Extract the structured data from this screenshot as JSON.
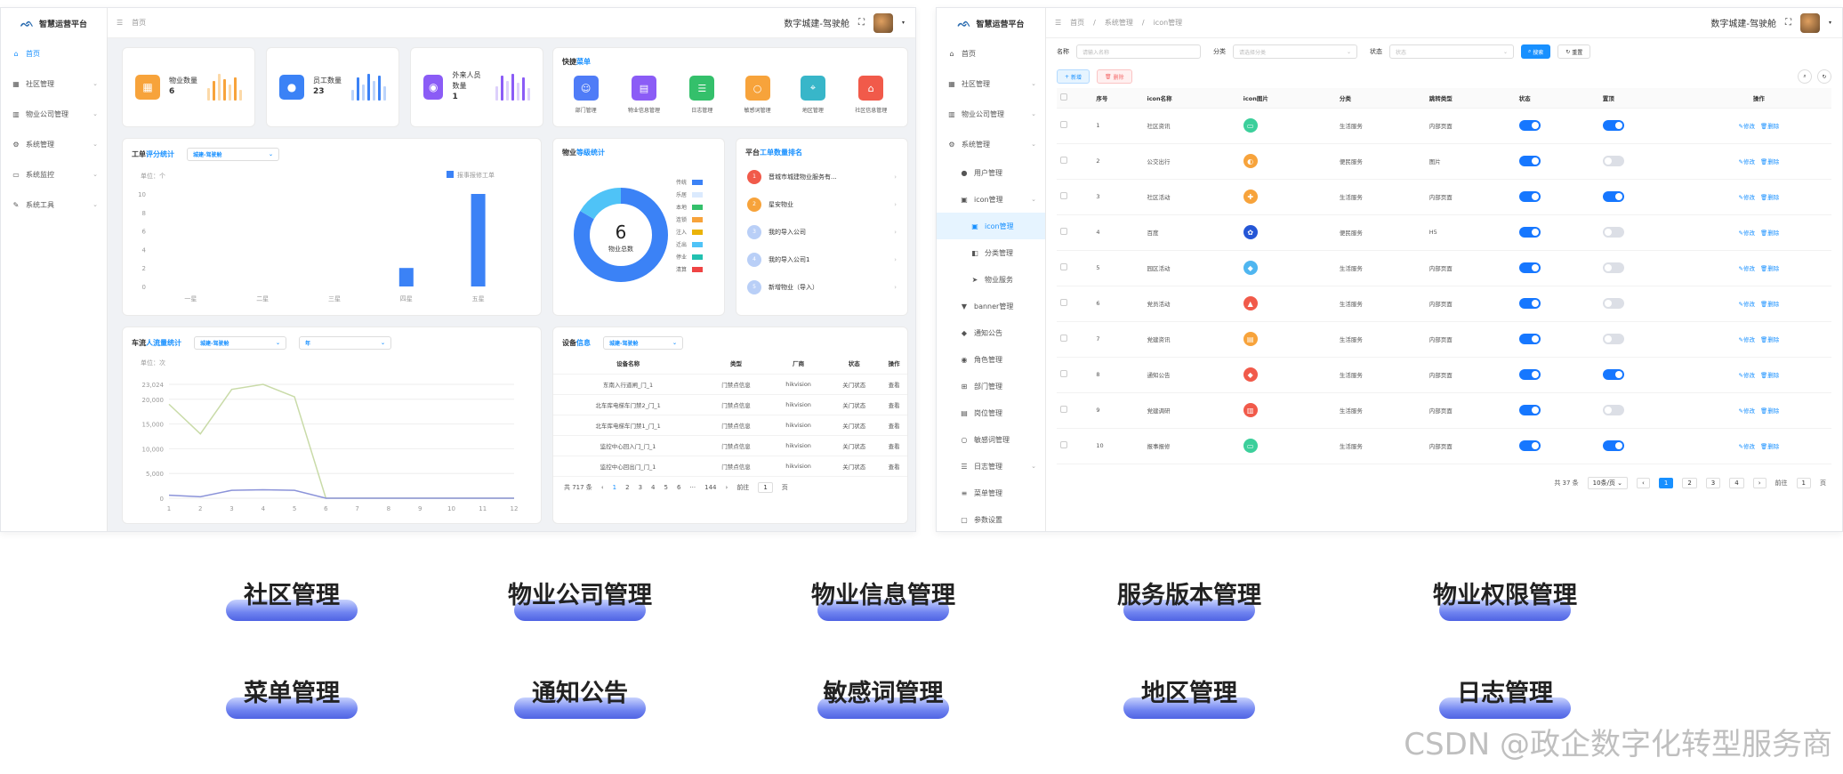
{
  "left": {
    "app_title": "智慧运营平台",
    "nav": [
      {
        "label": "首页",
        "icon": "home-icon",
        "active": true
      },
      {
        "label": "社区管理",
        "icon": "grid-icon"
      },
      {
        "label": "物业公司管理",
        "icon": "chart-icon"
      },
      {
        "label": "系统管理",
        "icon": "gear-icon"
      },
      {
        "label": "系统监控",
        "icon": "monitor-icon"
      },
      {
        "label": "系统工具",
        "icon": "tool-icon"
      }
    ],
    "breadcrumb": "首页",
    "user_label": "数字城建-驾驶舱",
    "stats": [
      {
        "label": "物业数量",
        "value": "6",
        "color": "#f7a33b",
        "icon": "building-icon"
      },
      {
        "label": "员工数量",
        "value": "23",
        "color": "#3b82f6",
        "icon": "person-icon"
      },
      {
        "label": "外来人员数量",
        "value": "1",
        "color": "#8b5cf6",
        "icon": "visitor-icon"
      }
    ],
    "quick": {
      "title_a": "快捷",
      "title_b": "菜单",
      "items": [
        {
          "label": "部门管理",
          "color": "#4f7cf7",
          "icon": "people-icon"
        },
        {
          "label": "物业信息管理",
          "color": "#8b5cf6",
          "icon": "doc-icon"
        },
        {
          "label": "日志管理",
          "color": "#34c06b",
          "icon": "log-icon"
        },
        {
          "label": "敏感词管理",
          "color": "#f7a33b",
          "icon": "word-icon"
        },
        {
          "label": "地区管理",
          "color": "#38b6c9",
          "icon": "map-icon"
        },
        {
          "label": "社区信息管理",
          "color": "#f15a4a",
          "icon": "community-icon"
        }
      ]
    },
    "ticket_chart": {
      "title_a": "工单",
      "title_b": "评分统计",
      "select": "城建-驾驶舱",
      "unit": "单位：个",
      "legend": "报事报修工单"
    },
    "property_chart": {
      "title_a": "物业",
      "title_b": "等级统计",
      "total_label": "物业总数"
    },
    "platform": {
      "title_a": "平台",
      "title_b": "工单数量排名",
      "items": [
        {
          "rank": "1",
          "name": "晋城市城建物业服务有...",
          "color": "#f15a4a"
        },
        {
          "rank": "2",
          "name": "星安物业",
          "color": "#f7a33b"
        },
        {
          "rank": "3",
          "name": "我的导入公司",
          "color": "#b9cff7"
        },
        {
          "rank": "4",
          "name": "我的导入公司1",
          "color": "#b9cff7"
        },
        {
          "rank": "5",
          "name": "新增物业（导入）",
          "color": "#b9cff7"
        }
      ]
    },
    "traffic_chart": {
      "title_a": "车流",
      "title_b": "人流量统计",
      "select1": "城建-驾驶舱",
      "select2": "年",
      "unit": "单位：次"
    },
    "device": {
      "title_a": "设备",
      "title_b": "信息",
      "select": "城建-驾驶舱",
      "headers": [
        "设备名称",
        "类型",
        "厂商",
        "状态",
        "操作"
      ],
      "rows": [
        [
          "东南入行道闸_门_1",
          "门禁点信息",
          "hikvision",
          "关门状态",
          "查看"
        ],
        [
          "北车库电梯车门禁2_门_1",
          "门禁点信息",
          "hikvision",
          "关门状态",
          "查看"
        ],
        [
          "北车库电梯车门禁1_门_1",
          "门禁点信息",
          "hikvision",
          "关门状态",
          "查看"
        ],
        [
          "监控中心回入门_门_1",
          "门禁点信息",
          "hikvision",
          "关门状态",
          "查看"
        ],
        [
          "监控中心回出门_门_1",
          "门禁点信息",
          "hikvision",
          "关门状态",
          "查看"
        ]
      ],
      "pager": {
        "total": "共 717 条",
        "pages": [
          "1",
          "2",
          "3",
          "4",
          "5",
          "6",
          "···",
          "144"
        ],
        "goto": "前往",
        "page": "1",
        "unit": "页"
      }
    }
  },
  "right": {
    "app_title": "智慧运营平台",
    "nav": [
      {
        "label": "首页",
        "icon": "home-icon",
        "level": 0
      },
      {
        "label": "社区管理",
        "icon": "grid-icon",
        "level": 0,
        "chev": true
      },
      {
        "label": "物业公司管理",
        "icon": "chart-icon",
        "level": 0,
        "chev": true
      },
      {
        "label": "系统管理",
        "icon": "gear-icon",
        "level": 0,
        "chev": true
      },
      {
        "label": "用户管理",
        "icon": "user-icon",
        "level": 1
      },
      {
        "label": "icon管理",
        "icon": "image-icon",
        "level": 1,
        "chev": true
      },
      {
        "label": "icon管理",
        "icon": "image-icon",
        "level": 2,
        "active": true
      },
      {
        "label": "分类管理",
        "icon": "tag-icon",
        "level": 2
      },
      {
        "label": "物业服务",
        "icon": "send-icon",
        "level": 2
      },
      {
        "label": "banner管理",
        "icon": "shirt-icon",
        "level": 1
      },
      {
        "label": "通知公告",
        "icon": "bell-icon",
        "level": 1
      },
      {
        "label": "角色管理",
        "icon": "role-icon",
        "level": 1
      },
      {
        "label": "部门管理",
        "icon": "org-icon",
        "level": 1
      },
      {
        "label": "岗位管理",
        "icon": "post-icon",
        "level": 1
      },
      {
        "label": "敏感词管理",
        "icon": "word-icon",
        "level": 1
      },
      {
        "label": "日志管理",
        "icon": "log-icon",
        "level": 1,
        "chev": true
      },
      {
        "label": "菜单管理",
        "icon": "menu-icon",
        "level": 1
      },
      {
        "label": "参数设置",
        "icon": "param-icon",
        "level": 1
      }
    ],
    "breadcrumb": [
      "首页",
      "系统管理",
      "icon管理"
    ],
    "user_label": "数字城建-驾驶舱",
    "filter": {
      "name_label": "名称",
      "name_placeholder": "请输入名称",
      "cat_label": "分类",
      "cat_placeholder": "请选择分类",
      "status_label": "状态",
      "status_placeholder": "状态",
      "search": "搜索",
      "reset": "重置",
      "add": "新增",
      "delete": "删除"
    },
    "table": {
      "headers": [
        "序号",
        "icon名称",
        "icon图片",
        "分类",
        "跳转类型",
        "状态",
        "置顶",
        "操作"
      ],
      "edit": "修改",
      "del": "删除",
      "rows": [
        {
          "no": "1",
          "name": "社区资讯",
          "cat": "生活服务",
          "type": "内部页面",
          "status": true,
          "top": true,
          "color": "#3ccf9b",
          "icon": "chat-icon"
        },
        {
          "no": "2",
          "name": "公交出行",
          "cat": "便民服务",
          "type": "图片",
          "status": true,
          "top": false,
          "color": "#f7a33b",
          "icon": "bus-icon"
        },
        {
          "no": "3",
          "name": "社区活动",
          "cat": "生活服务",
          "type": "内部页面",
          "status": true,
          "top": true,
          "color": "#f7a33b",
          "icon": "activity-icon"
        },
        {
          "no": "4",
          "name": "百度",
          "cat": "便民服务",
          "type": "H5",
          "status": true,
          "top": false,
          "color": "#2456d6",
          "icon": "baidu-icon"
        },
        {
          "no": "5",
          "name": "园区活动",
          "cat": "生活服务",
          "type": "内部页面",
          "status": true,
          "top": false,
          "color": "#4fb6f0",
          "icon": "park-icon"
        },
        {
          "no": "6",
          "name": "党员活动",
          "cat": "生活服务",
          "type": "内部页面",
          "status": true,
          "top": false,
          "color": "#f15a4a",
          "icon": "party-icon"
        },
        {
          "no": "7",
          "name": "党建资讯",
          "cat": "生活服务",
          "type": "内部页面",
          "status": true,
          "top": false,
          "color": "#f7a33b",
          "icon": "news-icon"
        },
        {
          "no": "8",
          "name": "通知公告",
          "cat": "生活服务",
          "type": "内部页面",
          "status": true,
          "top": true,
          "color": "#f15a4a",
          "icon": "bell-icon"
        },
        {
          "no": "9",
          "name": "党建调研",
          "cat": "生活服务",
          "type": "内部页面",
          "status": true,
          "top": false,
          "color": "#f15a4a",
          "icon": "survey-icon"
        },
        {
          "no": "10",
          "name": "报事报修",
          "cat": "生活服务",
          "type": "内部页面",
          "status": true,
          "top": true,
          "color": "#3ccf9b",
          "icon": "repair-icon"
        }
      ]
    },
    "pager": {
      "total": "共 37 条",
      "size": "10条/页",
      "pages": [
        "1",
        "2",
        "3",
        "4"
      ],
      "goto": "前往",
      "page": "1",
      "unit": "页"
    }
  },
  "features": [
    "社区管理",
    "物业公司管理",
    "物业信息管理",
    "服务版本管理",
    "物业权限管理",
    "菜单管理",
    "通知公告",
    "敏感词管理",
    "地区管理",
    "日志管理"
  ],
  "watermark": "CSDN @政企数字化转型服务商",
  "chart_data": [
    {
      "type": "bar",
      "categories": [
        "一星",
        "二星",
        "三星",
        "四星",
        "五星"
      ],
      "series": [
        {
          "name": "报事报修工单",
          "values": [
            0,
            0,
            0,
            2,
            10
          ]
        }
      ],
      "ylabel": "单位：个",
      "ylim": [
        0,
        10
      ],
      "yticks": [
        0,
        2,
        4,
        6,
        8,
        10
      ]
    },
    {
      "type": "pie",
      "total": 6,
      "total_label": "物业总数",
      "labels": [
        "传统",
        "乐居",
        "本地",
        "连锁",
        "注入",
        "迁出",
        "停业",
        "清算"
      ],
      "colors": [
        "#3b82f6",
        "#dbeafe",
        "#34c06b",
        "#f7a33b",
        "#eab308",
        "#4fc3f7",
        "#22c1b0",
        "#ef4444"
      ],
      "values": [
        5,
        0,
        0,
        0,
        0,
        1,
        0,
        0
      ]
    },
    {
      "type": "line",
      "x": [
        1,
        2,
        3,
        4,
        5,
        6,
        7,
        8,
        9,
        10,
        11,
        12
      ],
      "series": [
        {
          "name": "",
          "values": [
            19000,
            13000,
            22000,
            23024,
            20500,
            0,
            0,
            0,
            0,
            0,
            0,
            0
          ],
          "color": "#c9dba8"
        },
        {
          "name": "",
          "values": [
            600,
            300,
            1600,
            1700,
            1600,
            0,
            0,
            0,
            0,
            0,
            0,
            0
          ],
          "color": "#8b93d9"
        }
      ],
      "ylabel": "单位：次",
      "ylim": [
        0,
        23024
      ],
      "yticks": [
        0,
        5000,
        10000,
        15000,
        20000,
        23024
      ]
    }
  ]
}
